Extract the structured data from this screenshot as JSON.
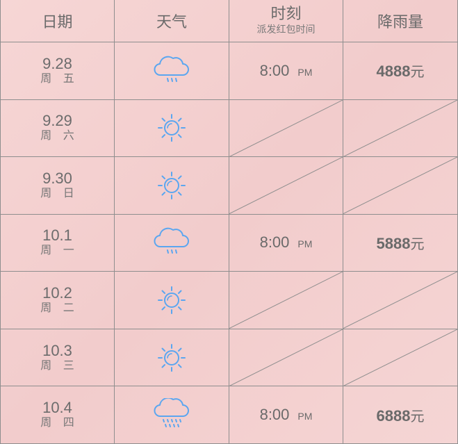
{
  "header": {
    "date": "日期",
    "weather": "天气",
    "time": "时刻",
    "time_sub": "派发红包时间",
    "amount": "降雨量"
  },
  "rows": [
    {
      "date": "9.28",
      "day": "周 五",
      "weather_icon": "rain-cloud-icon",
      "time": "8:00",
      "pm": "PM",
      "amount": "4888",
      "unit": "元"
    },
    {
      "date": "9.29",
      "day": "周 六",
      "weather_icon": "sun-icon"
    },
    {
      "date": "9.30",
      "day": "周 日",
      "weather_icon": "sun-icon"
    },
    {
      "date": "10.1",
      "day": "周 一",
      "weather_icon": "rain-cloud-icon",
      "time": "8:00",
      "pm": "PM",
      "amount": "5888",
      "unit": "元"
    },
    {
      "date": "10.2",
      "day": "周 二",
      "weather_icon": "sun-icon"
    },
    {
      "date": "10.3",
      "day": "周 三",
      "weather_icon": "sun-icon"
    },
    {
      "date": "10.4",
      "day": "周 四",
      "weather_icon": "heavy-rain-cloud-icon",
      "time": "8:00",
      "pm": "PM",
      "amount": "6888",
      "unit": "元"
    }
  ],
  "colors": {
    "icon": "#5aa6f0",
    "border": "#8e8e8e",
    "background": "#f5d3d3",
    "text": "#6e6e6e"
  }
}
